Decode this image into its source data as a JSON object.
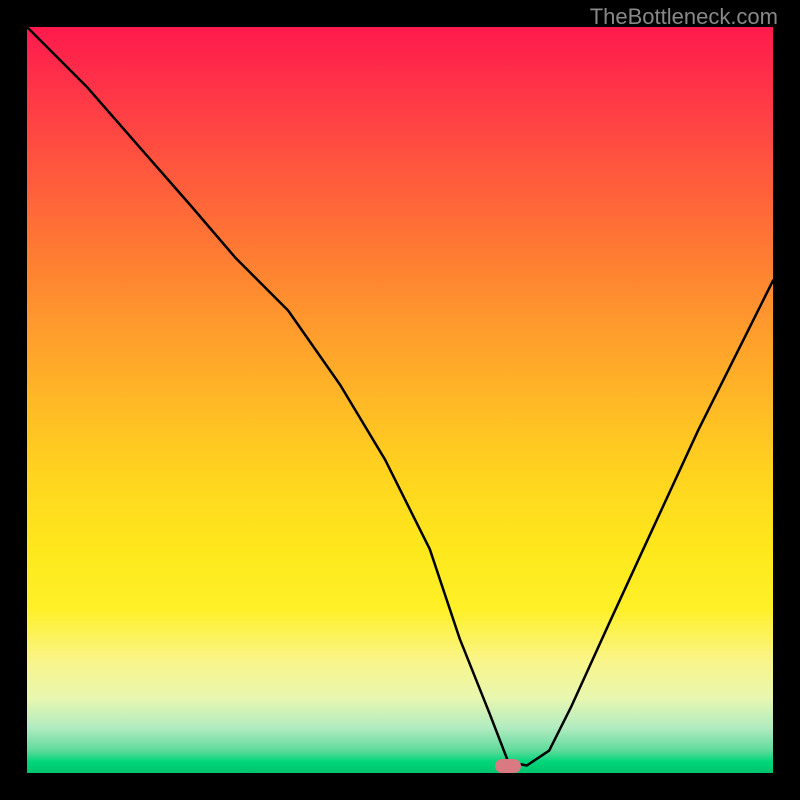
{
  "watermark": "TheBottleneck.com",
  "chart_data": {
    "type": "line",
    "title": "",
    "xlabel": "",
    "ylabel": "",
    "xlim": [
      0,
      100
    ],
    "ylim": [
      0,
      100
    ],
    "x": [
      0,
      8,
      15,
      22,
      28,
      35,
      42,
      48,
      54,
      58,
      62,
      64.5,
      67,
      70,
      73,
      78,
      84,
      90,
      96,
      100
    ],
    "values": [
      100,
      92,
      84,
      76,
      69,
      62,
      52,
      42,
      30,
      18,
      8,
      1.5,
      1,
      3,
      9,
      20,
      33,
      46,
      58,
      66
    ],
    "indicator_x": 64.5,
    "indicator_y": 1,
    "gradient_stops": [
      {
        "pos": 0,
        "color": "#ff1a4d"
      },
      {
        "pos": 50,
        "color": "#ffd41f"
      },
      {
        "pos": 98,
        "color": "#00d67a"
      }
    ]
  }
}
